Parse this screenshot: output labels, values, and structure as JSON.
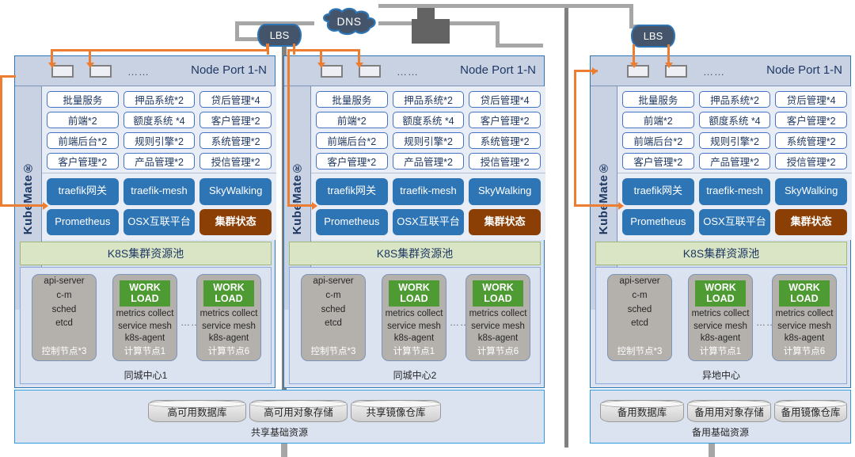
{
  "top": {
    "dns_label": "DNS",
    "lbs_left_label": "LBS",
    "lbs_right_label": "LBS"
  },
  "clusters": [
    {
      "id": "same-city-1",
      "node_port": {
        "title": "Node Port 1-N",
        "dots": "……"
      },
      "platform_label": "KubeMate®",
      "apps": [
        "批量服务",
        "押品系统*2",
        "贷后管理*4",
        "前端*2",
        "额度系统 *4",
        "客户管理*2",
        "前端后台*2",
        "规则引擎*2",
        "系统管理*2",
        "客户管理*2",
        "产品管理*2",
        "授信管理*2"
      ],
      "middleware": [
        {
          "label": "traefik网关",
          "style": "blue"
        },
        {
          "label": "traefik-mesh",
          "style": "blue"
        },
        {
          "label": "SkyWalking",
          "style": "blue"
        },
        {
          "label": "Prometheus",
          "style": "blue"
        },
        {
          "label": "OSX互联平台",
          "style": "blue"
        },
        {
          "label": "集群状态",
          "style": "brown"
        }
      ],
      "pool_label": "K8S集群资源池",
      "nodes": [
        {
          "type": "control",
          "lines": [
            "api-server",
            "c-m",
            "sched",
            "etcd"
          ],
          "footer": "控制节点*3"
        },
        {
          "type": "worker",
          "workload": "WORK LOAD",
          "lines": [
            "metrics collect",
            "service mesh",
            "k8s-agent"
          ],
          "footer": "计算节点1"
        },
        {
          "type": "worker",
          "workload": "WORK LOAD",
          "lines": [
            "metrics collect",
            "service mesh",
            "k8s-agent"
          ],
          "footer": "计算节点6"
        }
      ],
      "node_dots": "……",
      "datacenter_label": "同城中心1"
    },
    {
      "id": "same-city-2",
      "node_port": {
        "title": "Node Port 1-N",
        "dots": "……"
      },
      "platform_label": "KubeMate®",
      "apps": [
        "批量服务",
        "押品系统*2",
        "贷后管理*4",
        "前端*2",
        "额度系统 *4",
        "客户管理*2",
        "前端后台*2",
        "规则引擎*2",
        "系统管理*2",
        "客户管理*2",
        "产品管理*2",
        "授信管理*2"
      ],
      "middleware": [
        {
          "label": "traefik网关",
          "style": "blue"
        },
        {
          "label": "traefik-mesh",
          "style": "blue"
        },
        {
          "label": "SkyWalking",
          "style": "blue"
        },
        {
          "label": "Prometheus",
          "style": "blue"
        },
        {
          "label": "OSX互联平台",
          "style": "blue"
        },
        {
          "label": "集群状态",
          "style": "brown"
        }
      ],
      "pool_label": "K8S集群资源池",
      "nodes": [
        {
          "type": "control",
          "lines": [
            "api-server",
            "c-m",
            "sched",
            "etcd"
          ],
          "footer": "控制节点*3"
        },
        {
          "type": "worker",
          "workload": "WORK LOAD",
          "lines": [
            "metrics collect",
            "service mesh",
            "k8s-agent"
          ],
          "footer": "计算节点1"
        },
        {
          "type": "worker",
          "workload": "WORK LOAD",
          "lines": [
            "metrics collect",
            "service mesh",
            "k8s-agent"
          ],
          "footer": "计算节点6"
        }
      ],
      "node_dots": "……",
      "datacenter_label": "同城中心2"
    },
    {
      "id": "remote",
      "node_port": {
        "title": "Node Port 1-N",
        "dots": "……"
      },
      "platform_label": "KubeMate®",
      "apps": [
        "批量服务",
        "押品系统*2",
        "贷后管理*4",
        "前端*2",
        "额度系统 *4",
        "客户管理*2",
        "前端后台*2",
        "规则引擎*2",
        "系统管理*2",
        "客户管理*2",
        "产品管理*2",
        "授信管理*2"
      ],
      "middleware": [
        {
          "label": "traefik网关",
          "style": "blue"
        },
        {
          "label": "traefik-mesh",
          "style": "blue"
        },
        {
          "label": "SkyWalking",
          "style": "blue"
        },
        {
          "label": "Prometheus",
          "style": "blue"
        },
        {
          "label": "OSX互联平台",
          "style": "blue"
        },
        {
          "label": "集群状态",
          "style": "brown"
        }
      ],
      "pool_label": "K8S集群资源池",
      "nodes": [
        {
          "type": "control",
          "lines": [
            "api-server",
            "c-m",
            "sched",
            "etcd"
          ],
          "footer": "控制节点*3"
        },
        {
          "type": "worker",
          "workload": "WORK LOAD",
          "lines": [
            "metrics collect",
            "service mesh",
            "k8s-agent"
          ],
          "footer": "计算节点1"
        },
        {
          "type": "worker",
          "workload": "WORK LOAD",
          "lines": [
            "metrics collect",
            "service mesh",
            "k8s-agent"
          ],
          "footer": "计算节点6"
        }
      ],
      "node_dots": "……",
      "datacenter_label": "异地中心"
    }
  ],
  "infra_shared": {
    "items": [
      "高可用数据库",
      "高可用对象存储",
      "共享镜像仓库"
    ],
    "label": "共享基础资源"
  },
  "infra_backup": {
    "items": [
      "备用数据库",
      "备用用对象存储",
      "备用镜像仓库"
    ],
    "label": "备用基础资源"
  },
  "colors": {
    "accent_orange": "#ED7D31",
    "panel_blue": "#2E75B6",
    "brown": "#8C3F04",
    "workload_green": "#4E9A33",
    "pool_green": "#D9E5C4",
    "lbs_navy": "#44546A"
  }
}
